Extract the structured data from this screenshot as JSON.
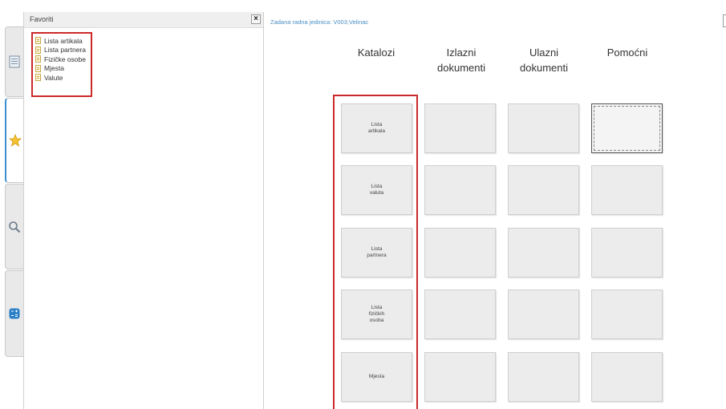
{
  "left_tabs": [
    {
      "icon": "document-list-icon",
      "active": false
    },
    {
      "icon": "star-icon",
      "active": true
    },
    {
      "icon": "search-icon",
      "active": false
    },
    {
      "icon": "calculator-icon",
      "active": false
    }
  ],
  "favorites": {
    "title": "Favoriti",
    "close": "×",
    "items": [
      "Lista artikala",
      "Lista partnera",
      "Fizičke osobe",
      "Mjesta",
      "Valute"
    ]
  },
  "main": {
    "info": "Zadana radna jedinica: V003;Velinac",
    "columns": [
      {
        "header": "Katalozi"
      },
      {
        "header": "Izlazni\ndokumenti"
      },
      {
        "header": "Ulazni\ndokumenti"
      },
      {
        "header": "Pomoćni"
      }
    ],
    "catalog_tiles": [
      "Lista\nartikala",
      "Lista\nvaluta",
      "Lista\npartnera",
      "Lista\nfizičkih\nosoba",
      "Mjesta"
    ]
  },
  "colors": {
    "highlight": "#cc2a2a",
    "accent": "#3a8fd0",
    "info_text": "#4a8fc4"
  }
}
